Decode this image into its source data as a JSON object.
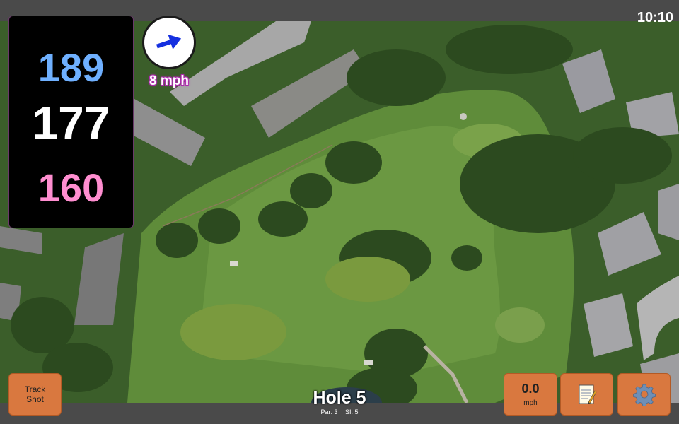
{
  "status": {
    "time": "10:10"
  },
  "distances": {
    "back": "189",
    "middle": "177",
    "front": "160"
  },
  "wind": {
    "speed_label": "8 mph",
    "icon": "arrow-right-icon"
  },
  "hole": {
    "title": "Hole 5",
    "par": "Par: 3",
    "si": "SI: 5"
  },
  "buttons": {
    "track_shot": "Track\nShot",
    "speed_value": "0.0",
    "speed_unit": "mph",
    "notes_icon": "notepad-icon",
    "settings_icon": "gear-icon"
  },
  "colors": {
    "back": "#6fb0ff",
    "middle": "#ffffff",
    "front": "#ff8ed0",
    "button": "#d9783f"
  }
}
